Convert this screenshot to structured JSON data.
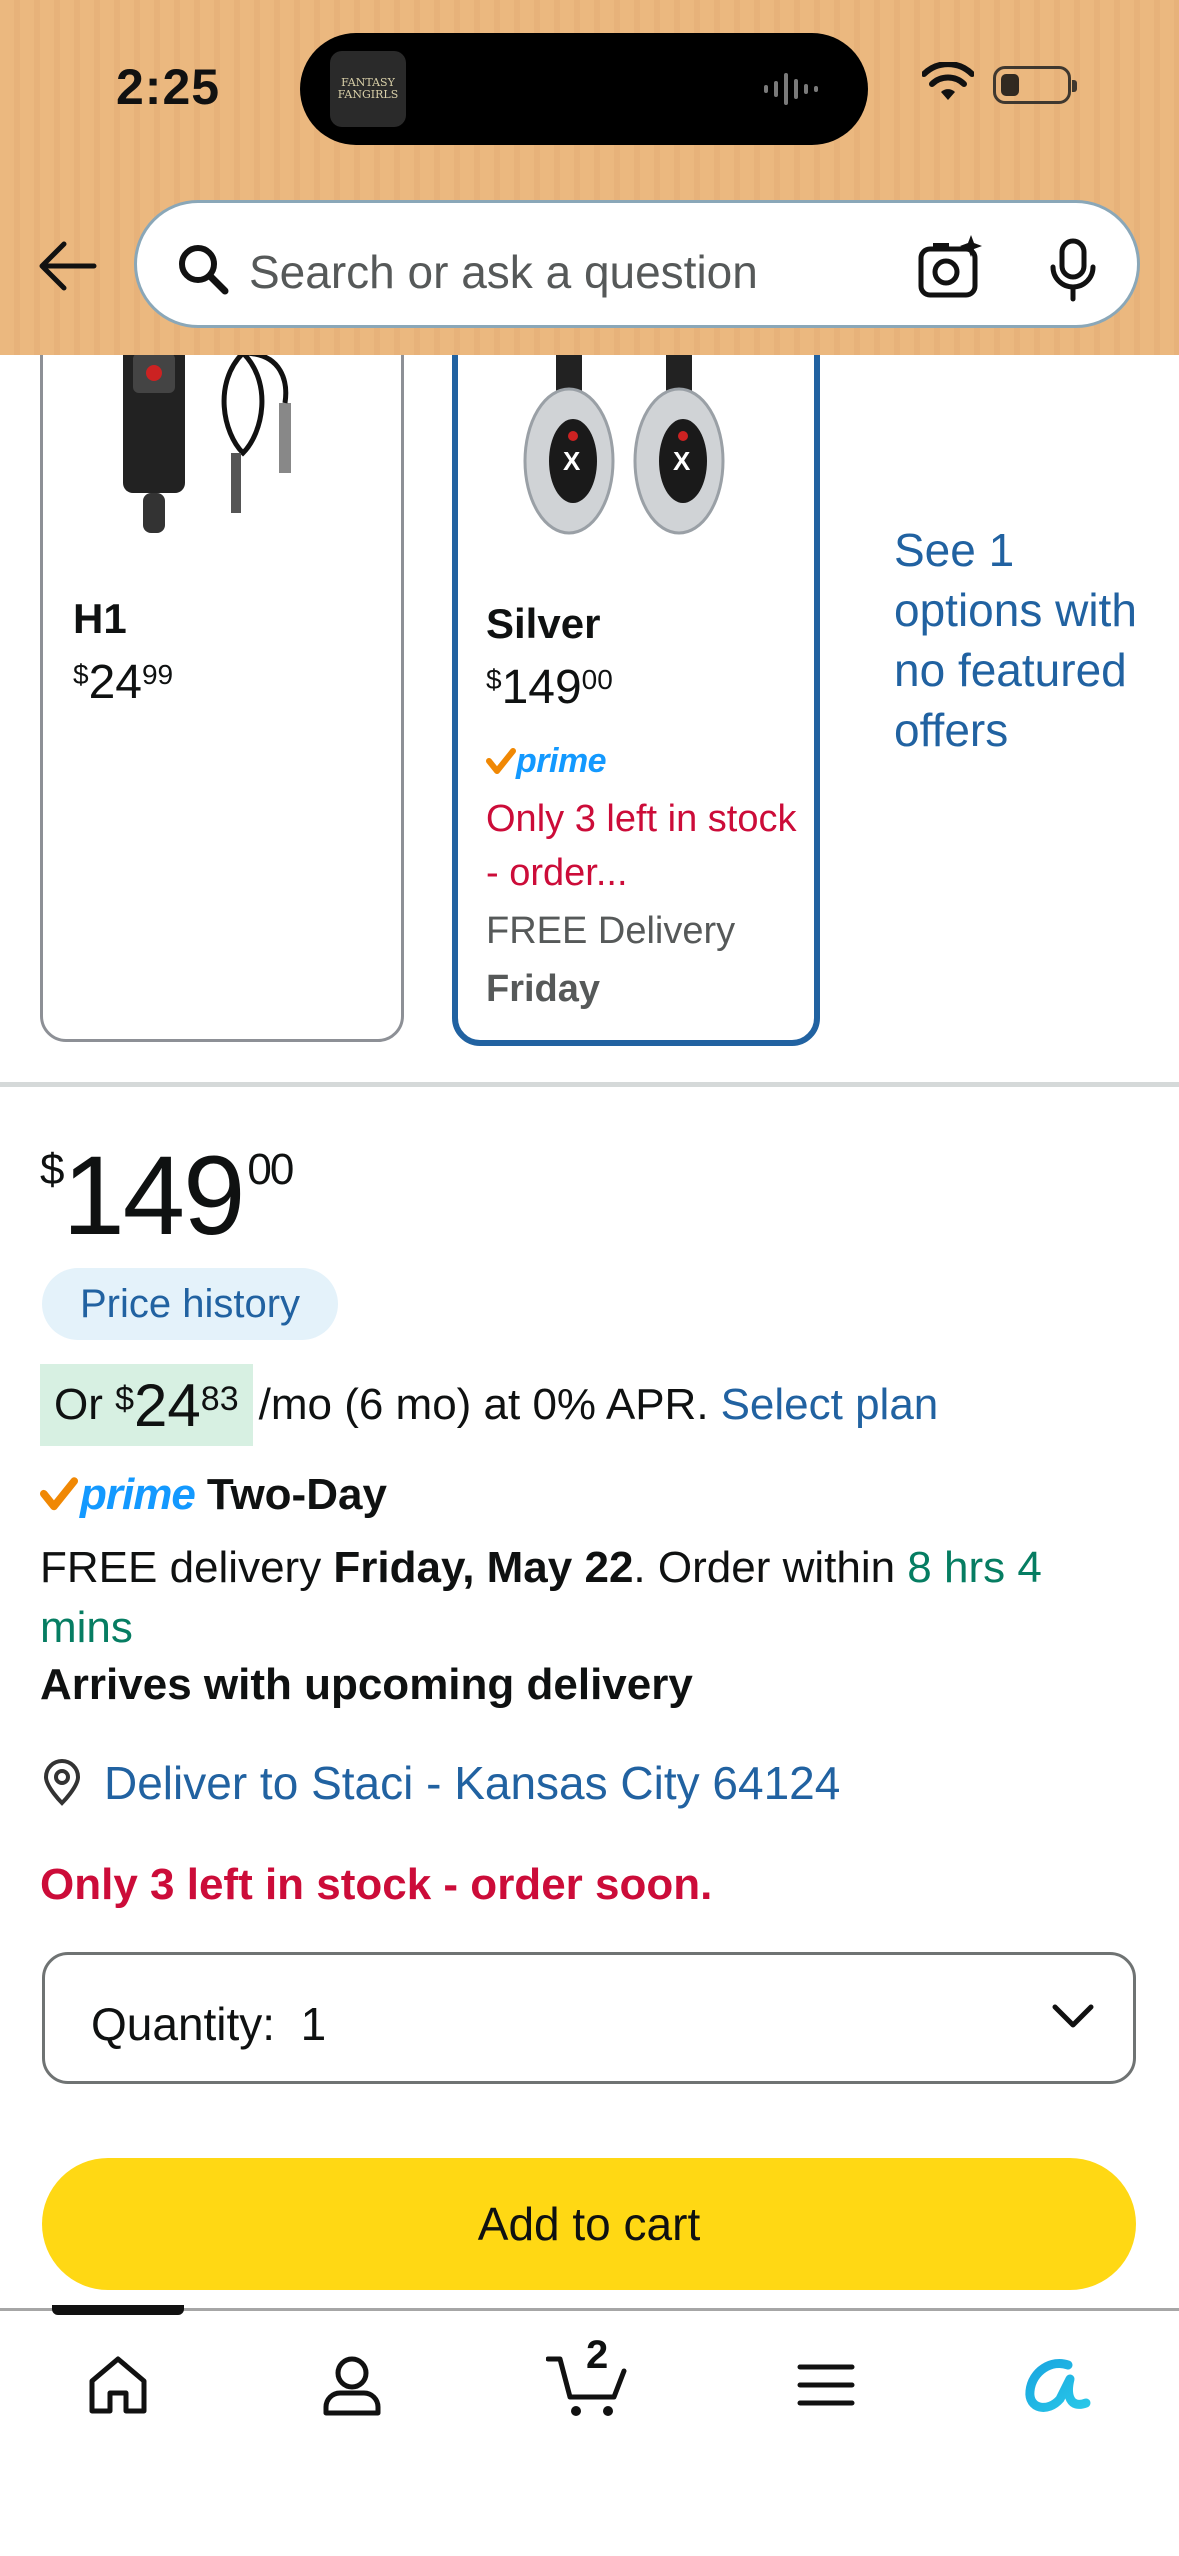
{
  "status_bar": {
    "time": "2:25",
    "island_app": "FANTASY FANGIRLS"
  },
  "header": {
    "search_placeholder": "Search or ask a question"
  },
  "variants": [
    {
      "name": "H1",
      "price_dollars": "24",
      "price_cents": "99",
      "selected": false
    },
    {
      "name": "Silver",
      "price_dollars": "149",
      "price_cents": "00",
      "selected": true,
      "prime_label": "prime",
      "stock_text": "Only 3 left in stock - order...",
      "delivery_label": "FREE Delivery",
      "delivery_day": "Friday"
    }
  ],
  "see_options_text": "See 1 options with no featured offers",
  "price": {
    "currency": "$",
    "dollars": "149",
    "cents": "00",
    "price_history_label": "Price history"
  },
  "installment": {
    "prefix": "Or",
    "currency": "$",
    "dollars": "24",
    "cents": "83",
    "suffix": "/mo (6 mo) at 0% APR.",
    "select_plan": "Select plan"
  },
  "delivery": {
    "prime_label": "prime",
    "speed": "Two-Day",
    "free_prefix": "FREE delivery",
    "date": "Friday, May 22",
    "order_within": ". Order within",
    "countdown": "8 hrs 4 mins",
    "arrives_note": "Arrives with upcoming delivery",
    "deliver_to": "Deliver to Staci - Kansas City 64124",
    "stock_warning": "Only 3 left in stock - order soon."
  },
  "quantity": {
    "label": "Quantity:",
    "value": "1"
  },
  "add_to_cart_label": "Add to cart",
  "bottom_nav": {
    "cart_count": "2",
    "items": [
      "home-icon",
      "account-icon",
      "cart-icon",
      "menu-icon",
      "rufus-icon"
    ]
  },
  "colors": {
    "header_bg": "#ebb87f",
    "link_blue": "#2162a1",
    "prime_blue": "#1399ff",
    "alert_red": "#cc0c39",
    "green": "#067d62",
    "cart_button": "#ffd814"
  }
}
